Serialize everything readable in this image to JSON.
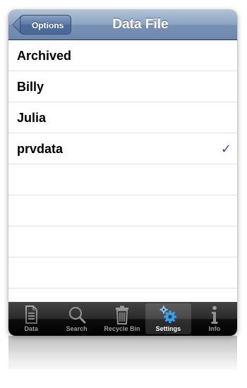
{
  "navbar": {
    "back_label": "Options",
    "title": "Data File"
  },
  "list": {
    "items": [
      {
        "label": "Archived",
        "checked": false
      },
      {
        "label": "Billy",
        "checked": false
      },
      {
        "label": "Julia",
        "checked": false
      },
      {
        "label": "prvdata",
        "checked": true
      }
    ],
    "checkmark": "✓"
  },
  "tabbar": {
    "selected": "Settings",
    "tabs": [
      {
        "label": "Data",
        "icon": "document-icon"
      },
      {
        "label": "Search",
        "icon": "search-icon"
      },
      {
        "label": "Recycle Bin",
        "icon": "trash-icon"
      },
      {
        "label": "Settings",
        "icon": "gear-icon"
      },
      {
        "label": "Info",
        "icon": "info-icon"
      }
    ]
  },
  "colors": {
    "navbar": "#7891b5",
    "checkmark": "#34558b",
    "tabbar": "#1a1a1a",
    "settings_gear": "#3aa0e6"
  }
}
